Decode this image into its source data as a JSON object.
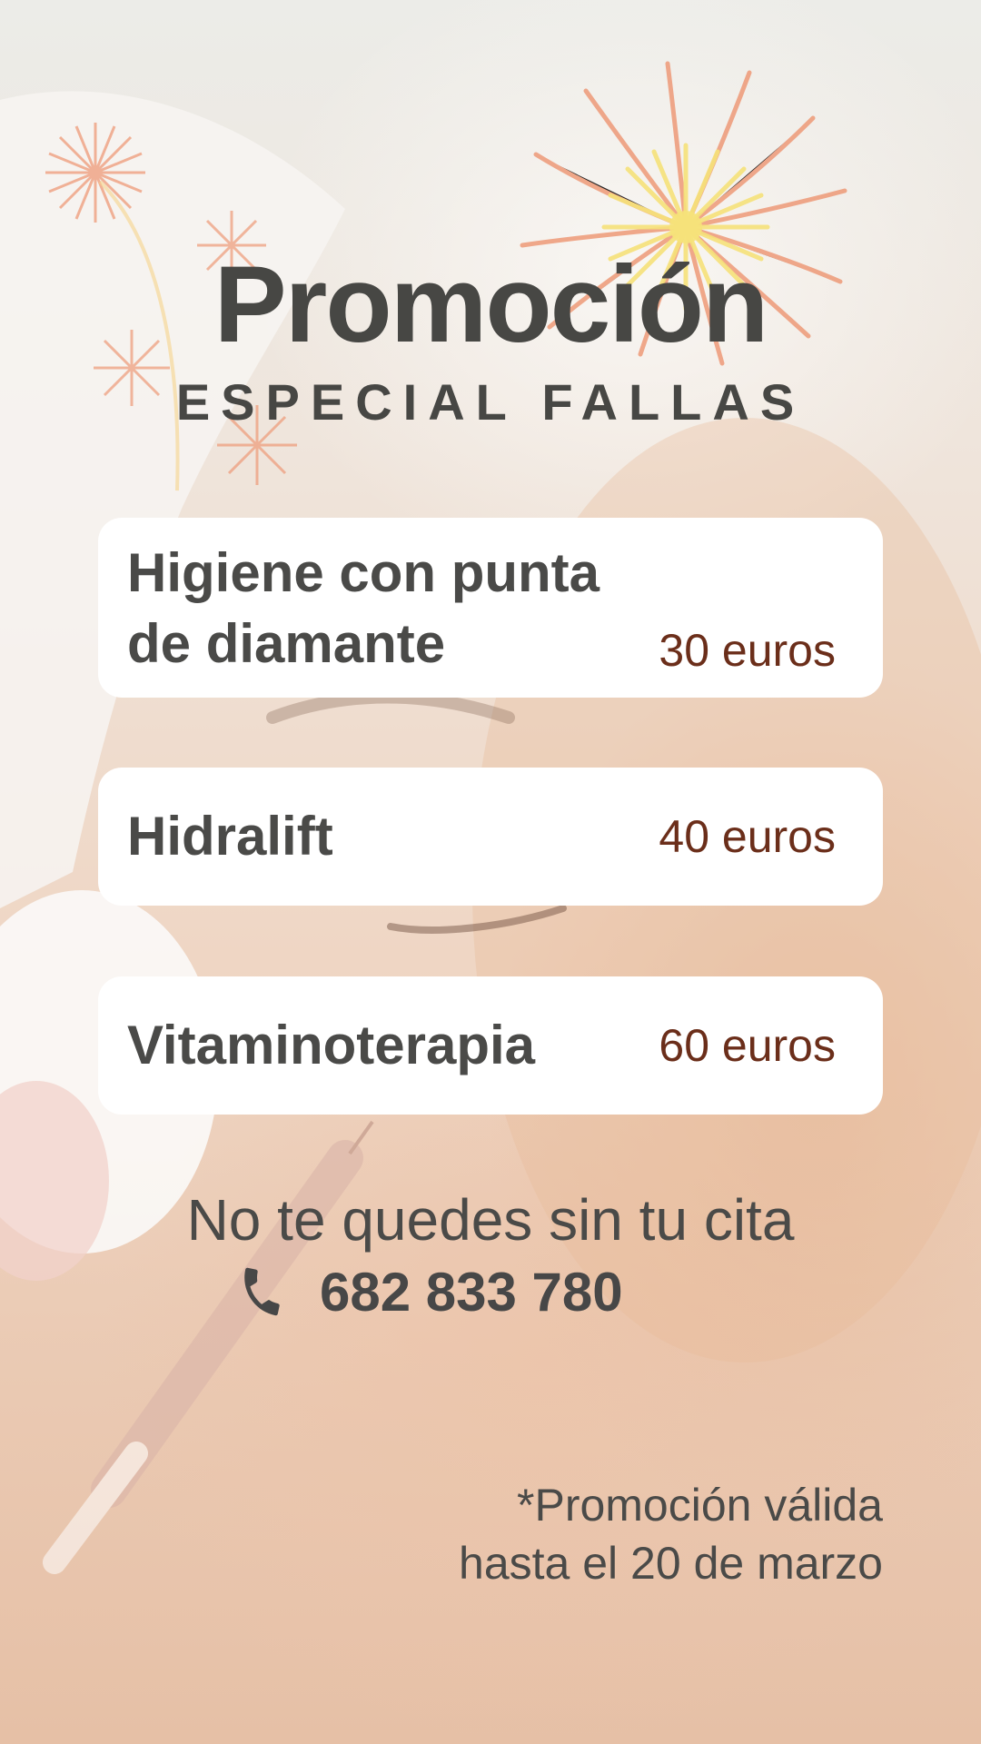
{
  "header": {
    "title": "Promoción",
    "subtitle": "ESPECIAL FALLAS"
  },
  "services": [
    {
      "name": "Higiene con punta\nde diamante",
      "price": "30 euros"
    },
    {
      "name": "Hidralift",
      "price": "40 euros"
    },
    {
      "name": "Vitaminoterapia",
      "price": "60 euros"
    }
  ],
  "cta": {
    "text": "No te quedes sin tu cita",
    "phone_icon": "phone-icon",
    "phone": "682 833 780"
  },
  "footer": {
    "note_line1": "*Promoción válida",
    "note_line2": "hasta el 20 de marzo"
  },
  "colors": {
    "text": "#474747",
    "price": "#6b2e1a",
    "card": "#ffffff",
    "firework_orange": "#ee9a78",
    "firework_yellow": "#f6e27a"
  }
}
